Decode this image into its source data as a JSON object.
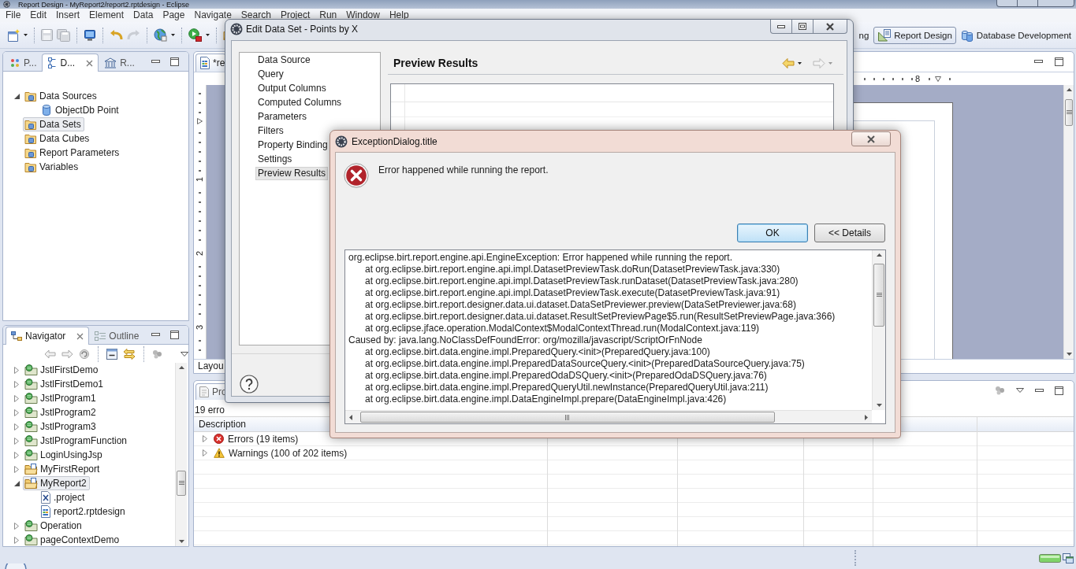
{
  "window": {
    "title": "Report Design - MyReport2/report2.rptdesign - Eclipse"
  },
  "menu": [
    "File",
    "Edit",
    "Insert",
    "Element",
    "Data",
    "Page",
    "Navigate",
    "Search",
    "Project",
    "Run",
    "Window",
    "Help"
  ],
  "perspectives": [
    {
      "label": "ng",
      "selected": false
    },
    {
      "label": "Report Design",
      "selected": true
    },
    {
      "label": "Database Development",
      "selected": false
    }
  ],
  "data_explorer": {
    "tabs": [
      {
        "label": "P...",
        "selected": false
      },
      {
        "label": "D...",
        "selected": true
      },
      {
        "label": "R...",
        "selected": false
      }
    ],
    "tree": [
      {
        "label": "Data Sources",
        "kind": "folder",
        "selected": false,
        "expanded": true,
        "children": [
          {
            "label": "ObjectDb Point",
            "kind": "data-source",
            "selected": false
          }
        ]
      },
      {
        "label": "Data Sets",
        "kind": "folder",
        "selected": true
      },
      {
        "label": "Data Cubes",
        "kind": "folder",
        "selected": false
      },
      {
        "label": "Report Parameters",
        "kind": "folder",
        "selected": false
      },
      {
        "label": "Variables",
        "kind": "folder",
        "selected": false
      }
    ]
  },
  "navigator": {
    "tabs": [
      {
        "label": "Navigator",
        "selected": true
      },
      {
        "label": "Outline",
        "selected": false
      }
    ],
    "tree": [
      {
        "label": "JstlFirstDemo",
        "kind": "web-project",
        "expanded": false,
        "selected": false
      },
      {
        "label": "JstlFirstDemo1",
        "kind": "web-project",
        "expanded": false,
        "selected": false
      },
      {
        "label": "JstlProgram1",
        "kind": "web-project",
        "expanded": false,
        "selected": false
      },
      {
        "label": "JstlProgram2",
        "kind": "web-project",
        "expanded": false,
        "selected": false
      },
      {
        "label": "JstlProgram3",
        "kind": "web-project",
        "expanded": false,
        "selected": false
      },
      {
        "label": "JstlProgramFunction",
        "kind": "web-project",
        "expanded": false,
        "selected": false
      },
      {
        "label": "LoginUsingJsp",
        "kind": "web-project",
        "expanded": false,
        "selected": false
      },
      {
        "label": "MyFirstReport",
        "kind": "report-project",
        "expanded": false,
        "selected": false
      },
      {
        "label": "MyReport2",
        "kind": "report-project",
        "expanded": true,
        "selected": true,
        "children": [
          {
            "label": ".project",
            "kind": "xml-file",
            "selected": false
          },
          {
            "label": "report2.rptdesign",
            "kind": "report-file",
            "selected": false
          }
        ]
      },
      {
        "label": "Operation",
        "kind": "web-project",
        "expanded": false,
        "selected": false
      },
      {
        "label": "pageContextDemo",
        "kind": "web-project",
        "expanded": false,
        "selected": false
      }
    ]
  },
  "editor": {
    "tabs": [
      {
        "label": "*re",
        "selected": true
      }
    ],
    "horizontal_ruler": [
      "8"
    ],
    "vertical_ruler": [
      "1",
      "2",
      "3"
    ],
    "bottom_tabs": [
      {
        "label": "Layou",
        "selected": true
      }
    ]
  },
  "problems": {
    "tabs": [
      {
        "label": "Pro",
        "selected": true
      }
    ],
    "summary": "19 erro",
    "columns": [
      "Description"
    ],
    "rows": [
      {
        "label": "Errors (19 items)",
        "kind": "error",
        "expanded": false
      },
      {
        "label": "Warnings (100 of 202 items)",
        "kind": "warning",
        "expanded": false
      }
    ]
  },
  "edit_data_set": {
    "title": "Edit Data Set - Points by X",
    "pages": [
      {
        "label": "Data Source",
        "selected": false
      },
      {
        "label": "Query",
        "selected": false
      },
      {
        "label": "Output Columns",
        "selected": false
      },
      {
        "label": "Computed Columns",
        "selected": false
      },
      {
        "label": "Parameters",
        "selected": false
      },
      {
        "label": "Filters",
        "selected": false
      },
      {
        "label": "Property Binding",
        "selected": false
      },
      {
        "label": "Settings",
        "selected": false
      },
      {
        "label": "Preview Results",
        "selected": true
      }
    ],
    "page_title": "Preview Results"
  },
  "exception_dialog": {
    "title": "ExceptionDialog.title",
    "message": "Error happened while running the report.",
    "buttons": [
      {
        "label": "OK",
        "kind": "default"
      },
      {
        "label": "<< Details",
        "kind": "normal"
      }
    ],
    "details": [
      {
        "text": "org.eclipse.birt.report.engine.api.EngineException: Error happened while running the report.",
        "children": [
          "at org.eclipse.birt.report.engine.api.impl.DatasetPreviewTask.doRun(DatasetPreviewTask.java:330)",
          "at org.eclipse.birt.report.engine.api.impl.DatasetPreviewTask.runDataset(DatasetPreviewTask.java:280)",
          "at org.eclipse.birt.report.engine.api.impl.DatasetPreviewTask.execute(DatasetPreviewTask.java:91)",
          "at org.eclipse.birt.report.designer.data.ui.dataset.DataSetPreviewer.preview(DataSetPreviewer.java:68)",
          "at org.eclipse.birt.report.designer.data.ui.dataset.ResultSetPreviewPage$5.run(ResultSetPreviewPage.java:366)",
          "at org.eclipse.jface.operation.ModalContext$ModalContextThread.run(ModalContext.java:119)"
        ]
      },
      {
        "text": "Caused by: java.lang.NoClassDefFoundError: org/mozilla/javascript/ScriptOrFnNode",
        "children": [
          "at org.eclipse.birt.data.engine.impl.PreparedQuery.<init>(PreparedQuery.java:100)",
          "at org.eclipse.birt.data.engine.impl.PreparedDataSourceQuery.<init>(PreparedDataSourceQuery.java:75)",
          "at org.eclipse.birt.data.engine.impl.PreparedOdaDSQuery.<init>(PreparedOdaDSQuery.java:76)",
          "at org.eclipse.birt.data.engine.impl.PreparedQueryUtil.newInstance(PreparedQueryUtil.java:211)",
          "at org.eclipse.birt.data.engine.impl.DataEngineImpl.prepare(DataEngineImpl.java:426)"
        ]
      }
    ]
  }
}
